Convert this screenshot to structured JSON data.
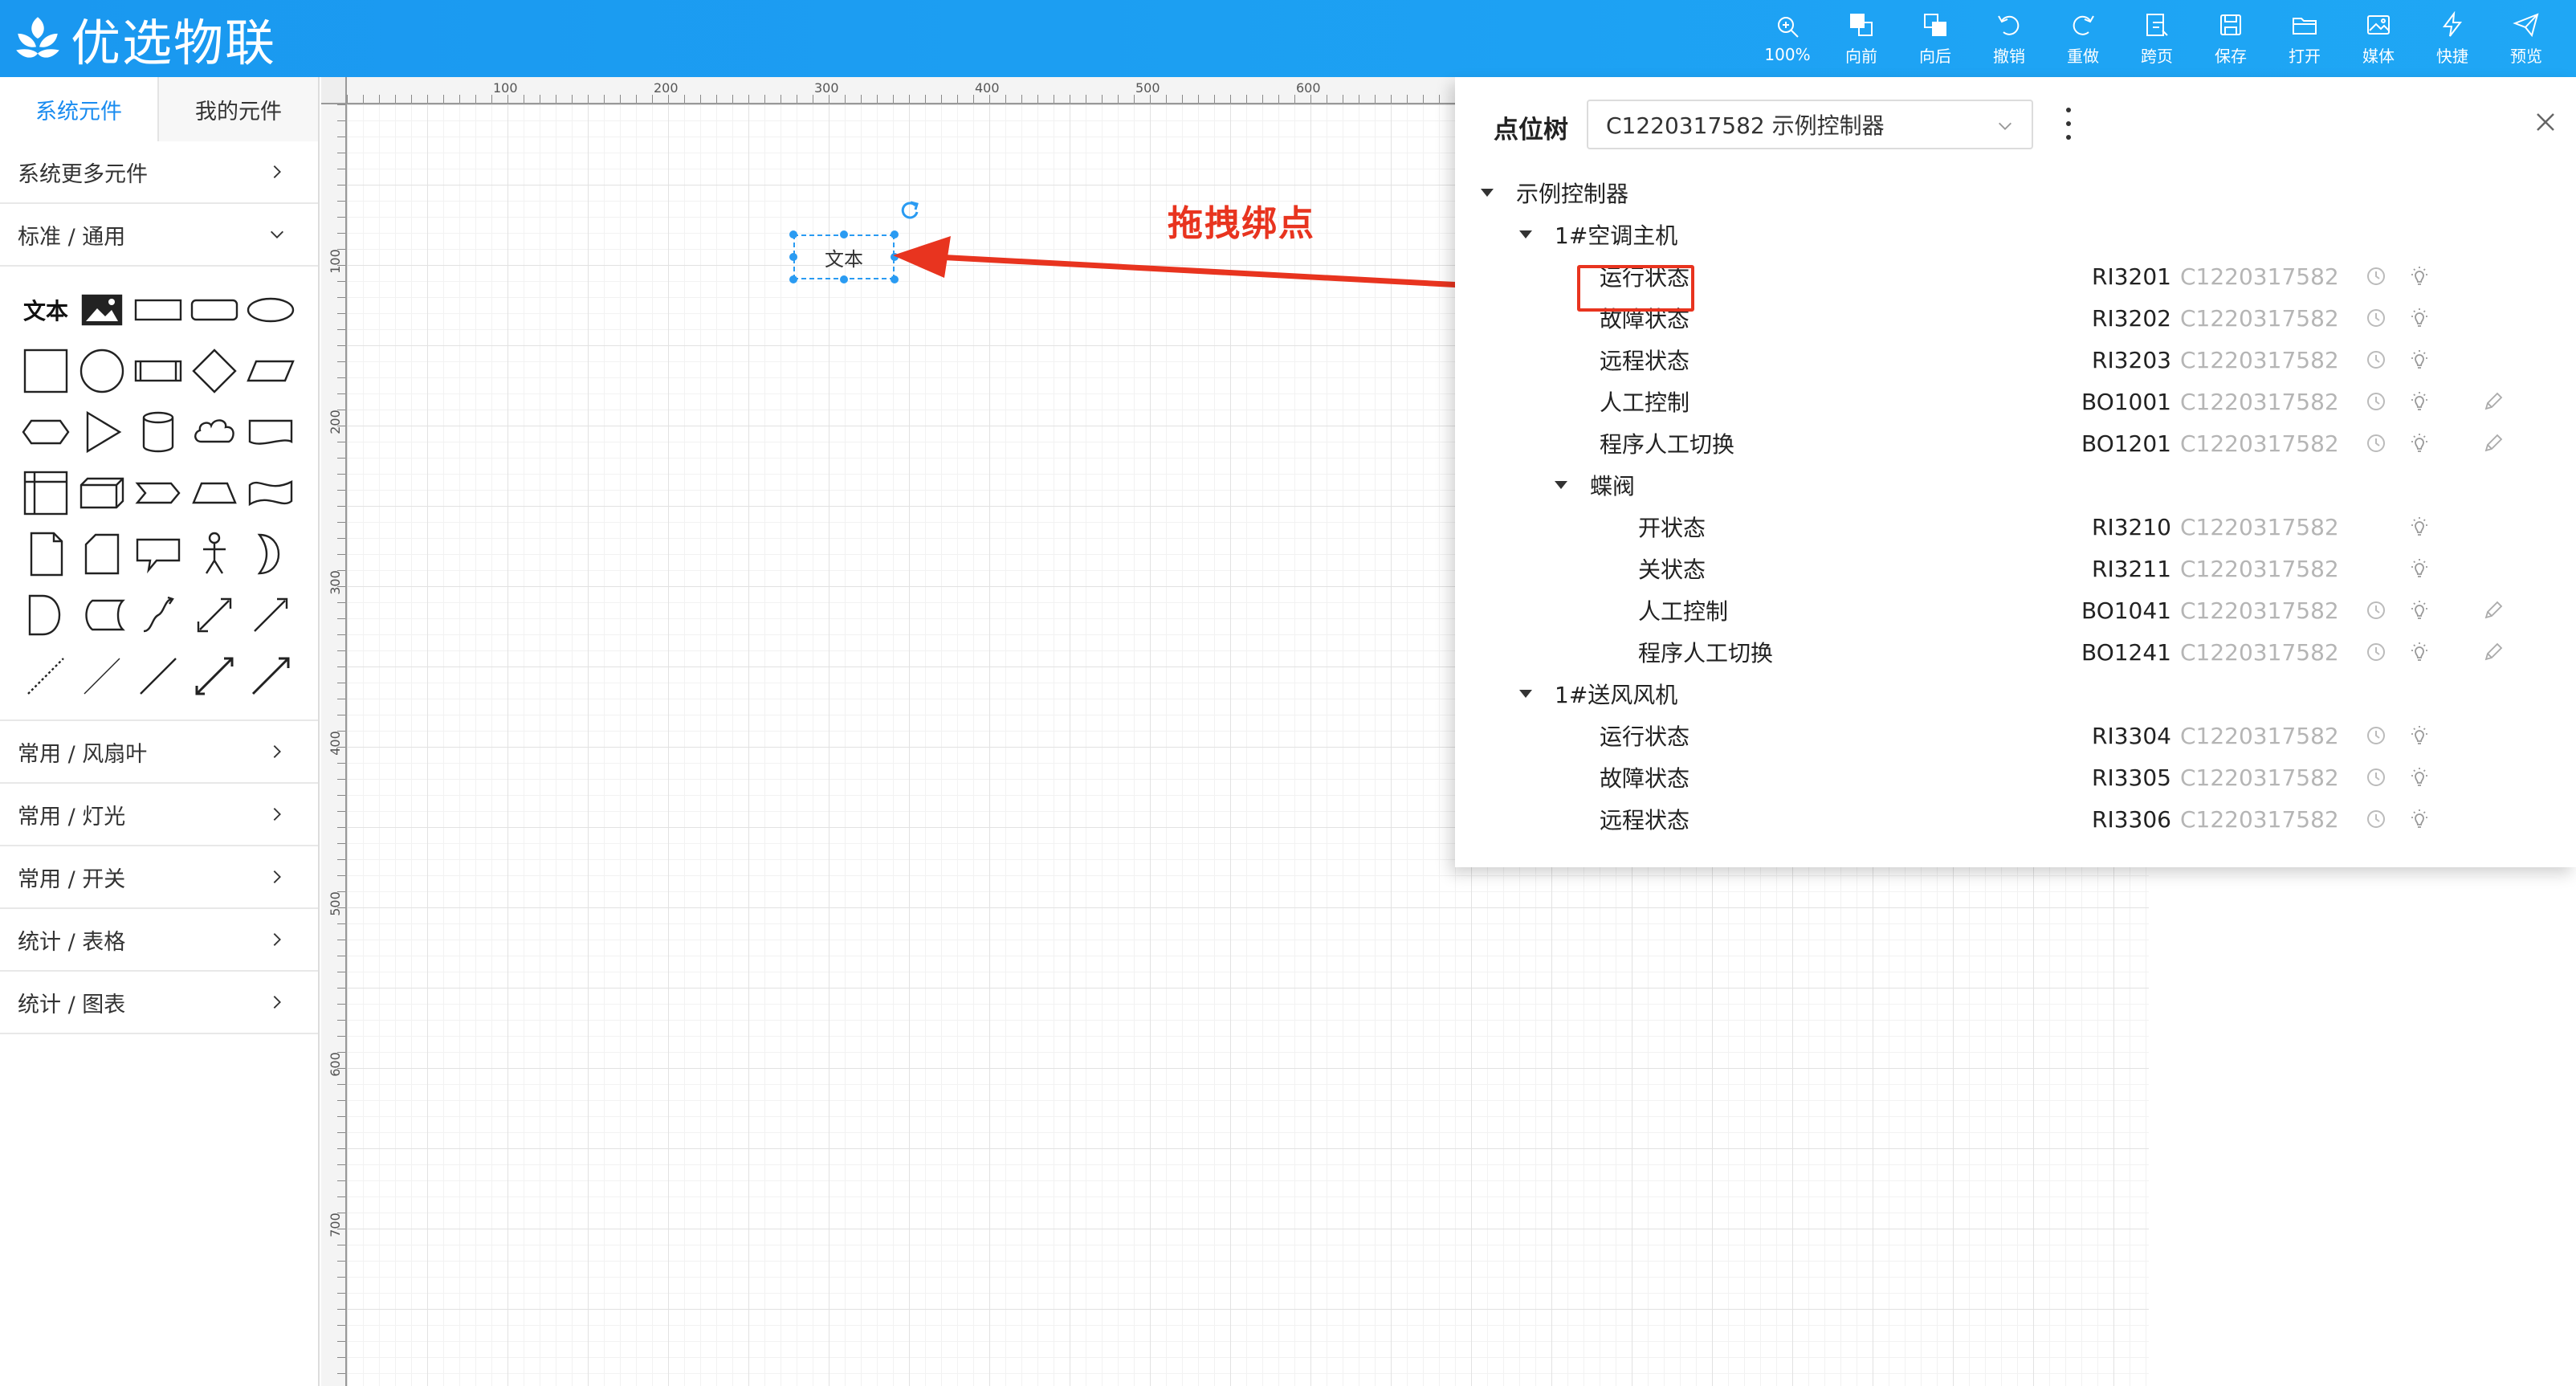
{
  "header": {
    "logo_text": "优选物联",
    "toolbar": [
      {
        "label": "100%",
        "icon": "zoom-icon"
      },
      {
        "label": "向前",
        "icon": "bring-forward-icon"
      },
      {
        "label": "向后",
        "icon": "send-backward-icon"
      },
      {
        "label": "撤销",
        "icon": "undo-icon"
      },
      {
        "label": "重做",
        "icon": "redo-icon"
      },
      {
        "label": "跨页",
        "icon": "cross-page-icon"
      },
      {
        "label": "保存",
        "icon": "save-icon"
      },
      {
        "label": "打开",
        "icon": "folder-icon"
      },
      {
        "label": "媒体",
        "icon": "media-icon"
      },
      {
        "label": "快捷",
        "icon": "lightning-icon"
      },
      {
        "label": "预览",
        "icon": "send-icon"
      }
    ]
  },
  "sidebar": {
    "tabs": [
      "系统元件",
      "我的元件"
    ],
    "more": "系统更多元件",
    "standard": "标准 / 通用",
    "text_shape_label": "文本",
    "categories": [
      "常用 / 风扇叶",
      "常用 / 灯光",
      "常用 / 开关",
      "统计 / 表格",
      "统计 / 图表"
    ]
  },
  "canvas": {
    "ruler_top": [
      "100",
      "200",
      "300",
      "400",
      "500",
      "600"
    ],
    "ruler_left": [
      "100",
      "200",
      "300",
      "400",
      "500",
      "600",
      "700"
    ],
    "text_element": "文本",
    "annotation": "拖拽绑点"
  },
  "panel": {
    "title": "点位树",
    "selector_value": "C1220317582 示例控制器",
    "tree": [
      {
        "label": "示例控制器",
        "level": 0,
        "expandable": true,
        "code": "",
        "device": ""
      },
      {
        "label": "1#空调主机",
        "level": 1,
        "expandable": true,
        "code": "",
        "device": ""
      },
      {
        "label": "运行状态",
        "level": 2,
        "code": "RI3201",
        "device": "C1220317582",
        "icons": [
          "history",
          "bulb"
        ],
        "highlighted": true
      },
      {
        "label": "故障状态",
        "level": 2,
        "code": "RI3202",
        "device": "C1220317582",
        "icons": [
          "history",
          "bulb"
        ]
      },
      {
        "label": "远程状态",
        "level": 2,
        "code": "RI3203",
        "device": "C1220317582",
        "icons": [
          "history",
          "bulb"
        ]
      },
      {
        "label": "人工控制",
        "level": 2,
        "code": "BO1001",
        "device": "C1220317582",
        "icons": [
          "history",
          "bulb",
          "edit"
        ]
      },
      {
        "label": "程序人工切换",
        "level": 2,
        "code": "BO1201",
        "device": "C1220317582",
        "icons": [
          "history",
          "bulb",
          "edit"
        ]
      },
      {
        "label": "蝶阀",
        "level": 2,
        "expandable": true,
        "code": "",
        "device": ""
      },
      {
        "label": "开状态",
        "level": 3,
        "code": "RI3210",
        "device": "C1220317582",
        "icons": [
          "bulb"
        ]
      },
      {
        "label": "关状态",
        "level": 3,
        "code": "RI3211",
        "device": "C1220317582",
        "icons": [
          "bulb"
        ]
      },
      {
        "label": "人工控制",
        "level": 3,
        "code": "BO1041",
        "device": "C1220317582",
        "icons": [
          "history",
          "bulb",
          "edit"
        ]
      },
      {
        "label": "程序人工切换",
        "level": 3,
        "code": "BO1241",
        "device": "C1220317582",
        "icons": [
          "history",
          "bulb",
          "edit"
        ]
      },
      {
        "label": "1#送风风机",
        "level": 1,
        "expandable": true,
        "code": "",
        "device": ""
      },
      {
        "label": "运行状态",
        "level": 2,
        "code": "RI3304",
        "device": "C1220317582",
        "icons": [
          "history",
          "bulb"
        ]
      },
      {
        "label": "故障状态",
        "level": 2,
        "code": "RI3305",
        "device": "C1220317582",
        "icons": [
          "history",
          "bulb"
        ]
      },
      {
        "label": "远程状态",
        "level": 2,
        "code": "RI3306",
        "device": "C1220317582",
        "icons": [
          "history",
          "bulb"
        ]
      }
    ]
  },
  "colors": {
    "header": "#1a98f0",
    "accent": "#1a8cf0",
    "annotation": "#e8341f"
  }
}
